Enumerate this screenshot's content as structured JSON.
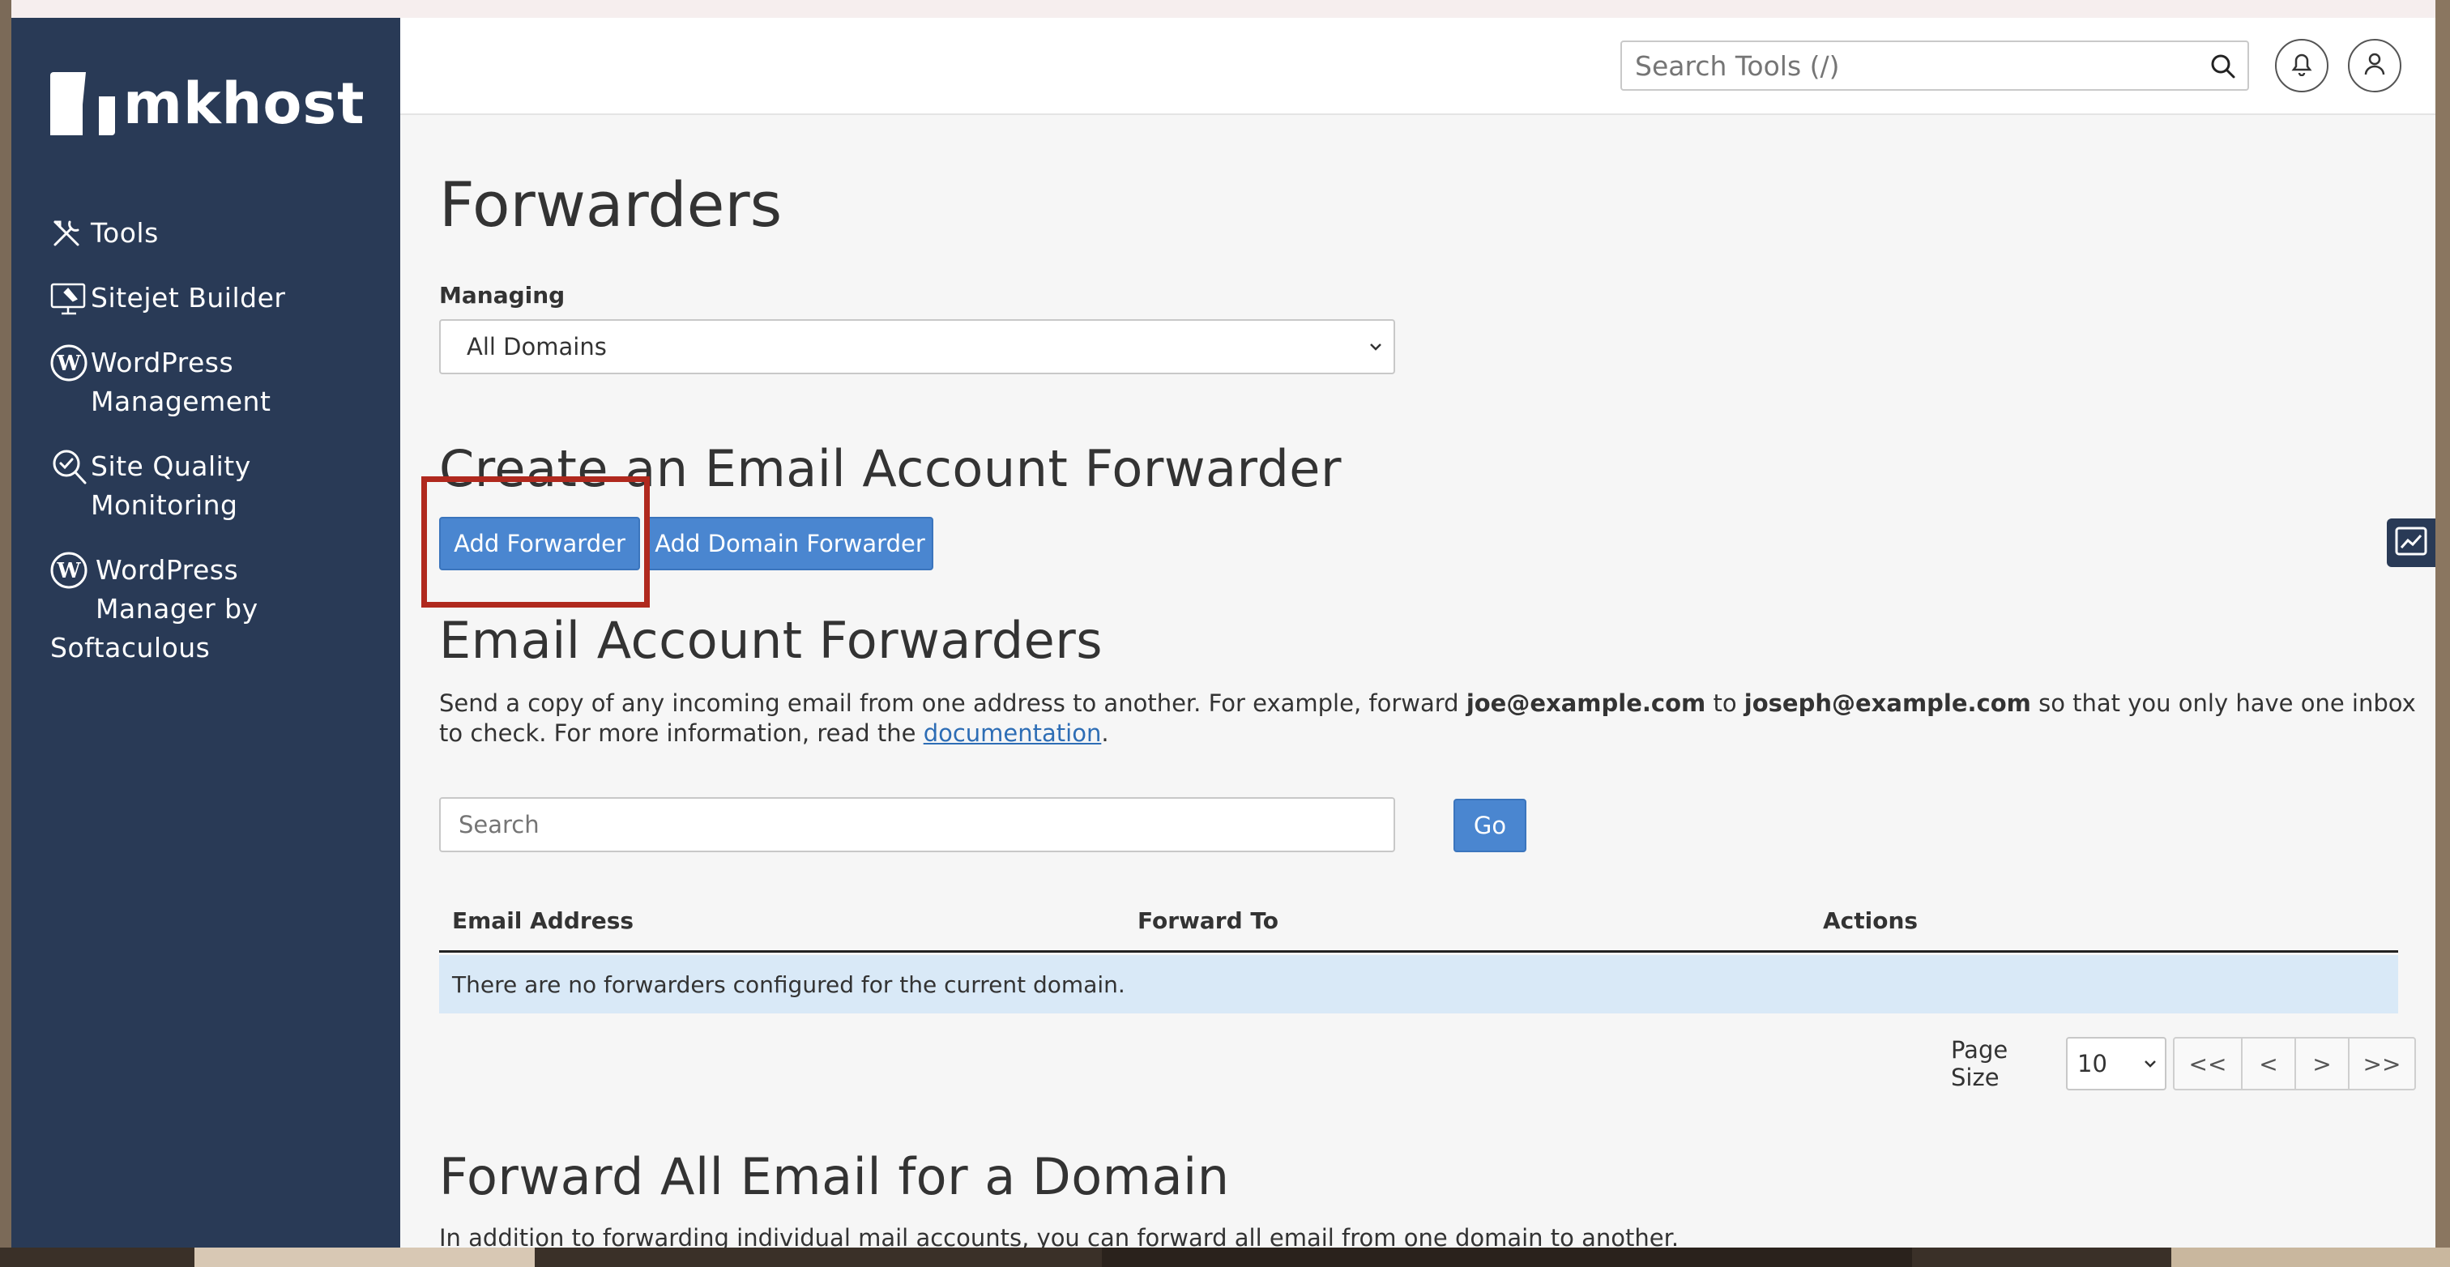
{
  "brand": {
    "name": "mkhost"
  },
  "sidebar": {
    "items": [
      {
        "label": "Tools",
        "icon": "tools-icon"
      },
      {
        "label": "Sitejet Builder",
        "icon": "sitejet-icon"
      },
      {
        "label": "WordPress\nManagement",
        "icon": "wordpress-icon"
      },
      {
        "label": "Site Quality\nMonitoring",
        "icon": "site-quality-icon"
      },
      {
        "label": "WordPress\nManager by",
        "label_wrap": "Softaculous",
        "icon": "wordpress-icon"
      }
    ]
  },
  "header": {
    "search_placeholder": "Search Tools (/)",
    "notifications_icon": "bell-icon",
    "user_icon": "user-icon"
  },
  "main": {
    "title": "Forwarders",
    "managing_label": "Managing",
    "managing_value": "All Domains",
    "create_heading": "Create an Email Account Forwarder",
    "add_forwarder_label": "Add Forwarder",
    "add_domain_forwarder_label": "Add Domain Forwarder",
    "list_heading": "Email Account Forwarders",
    "description": {
      "part1": "Send a copy of any incoming email from one address to another. For example, forward ",
      "example_from": "joe@example.com",
      "part2": " to ",
      "example_to": "joseph@example.com",
      "part3": " so that you only have one inbox to check. For more information, read the ",
      "link": "documentation",
      "part4": "."
    },
    "search_placeholder": "Search",
    "go_label": "Go",
    "table": {
      "columns": [
        "Email Address",
        "Forward To",
        "Actions"
      ],
      "empty_message": "There are no forwarders configured for the current domain."
    },
    "pager": {
      "page_size_label": "Page Size",
      "page_size_value": "10",
      "first": "<<",
      "prev": "<",
      "next": ">",
      "last": ">>"
    },
    "domain_heading": "Forward All Email for a Domain",
    "domain_description": "In addition to forwarding individual mail accounts, you can forward all email from one domain to another."
  },
  "colors": {
    "sidebar_bg": "#293a56",
    "primary": "#4a86d0",
    "highlight": "#b0291e",
    "empty_row_bg": "#d9e9f7"
  }
}
